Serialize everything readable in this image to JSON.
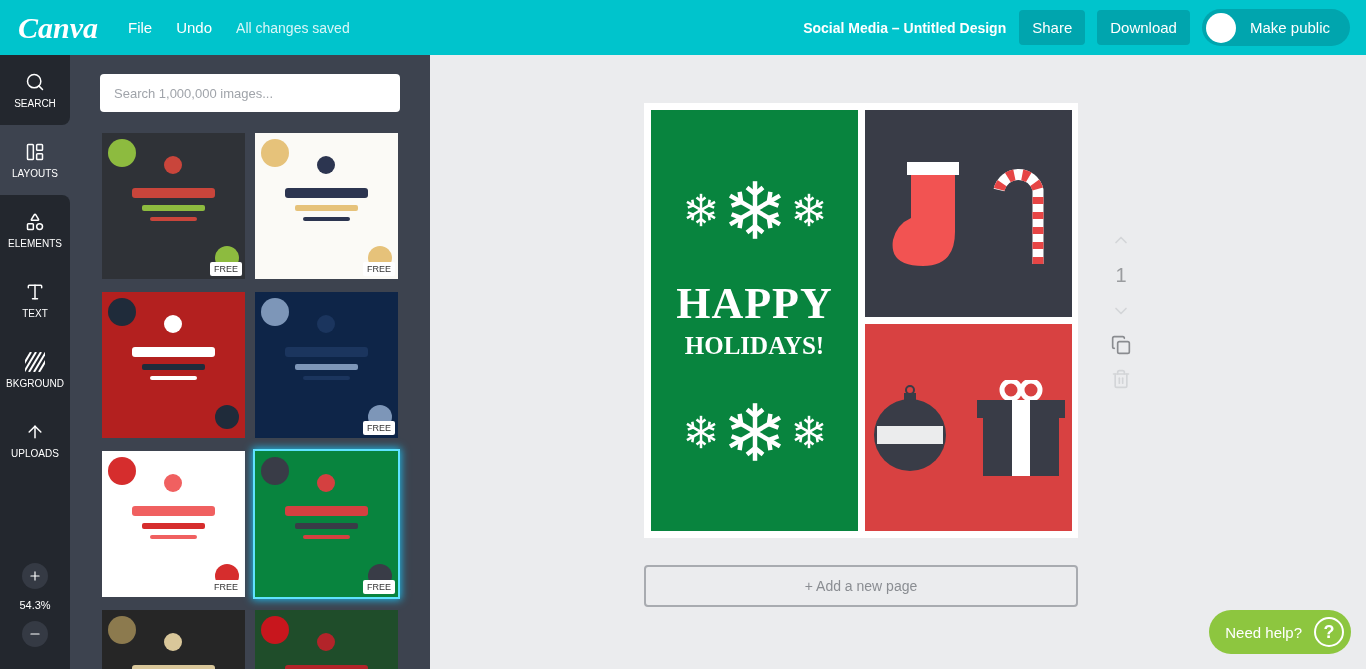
{
  "topbar": {
    "logo": "Canva",
    "menu": [
      "File",
      "Undo"
    ],
    "status": "All changes saved",
    "design_title": "Social Media – Untitled Design",
    "buttons": [
      "Share",
      "Download"
    ],
    "toggle": {
      "label": "Make public",
      "on": false
    }
  },
  "sidebar": {
    "items": [
      {
        "label": "SEARCH",
        "kind": "search",
        "selected": false
      },
      {
        "label": "LAYOUTS",
        "kind": "layouts",
        "selected": true
      },
      {
        "label": "ELEMENTS",
        "kind": "elements",
        "selected": false
      },
      {
        "label": "TEXT",
        "kind": "text",
        "selected": false
      },
      {
        "label": "BKGROUND",
        "kind": "background",
        "selected": false
      },
      {
        "label": "UPLOADS",
        "kind": "uploads",
        "selected": false
      }
    ],
    "zoom": "54.3%"
  },
  "panel": {
    "search": {
      "placeholder": "Search 1,000,000 images..."
    },
    "templates": [
      {
        "kind": "picture",
        "badge": "FREE",
        "selected": false
      },
      {
        "kind": "picture",
        "badge": "FREE",
        "selected": false
      },
      {
        "kind": "picture",
        "selected": false
      },
      {
        "kind": "picture",
        "badge": "FREE",
        "selected": false
      },
      {
        "kind": "picture",
        "badge": "FREE",
        "selected": false
      },
      {
        "kind": "picture",
        "badge": "FREE",
        "selected": true
      },
      {
        "kind": "picture",
        "selected": false
      },
      {
        "kind": "picture",
        "selected": false
      }
    ]
  },
  "design": {
    "headline": "HAPPY",
    "subline": "HOLIDAYS!"
  },
  "page_controls": {
    "page_number": "1"
  },
  "add_page": "+ Add a new page",
  "help": {
    "label": "Need help?",
    "icon": "?"
  }
}
